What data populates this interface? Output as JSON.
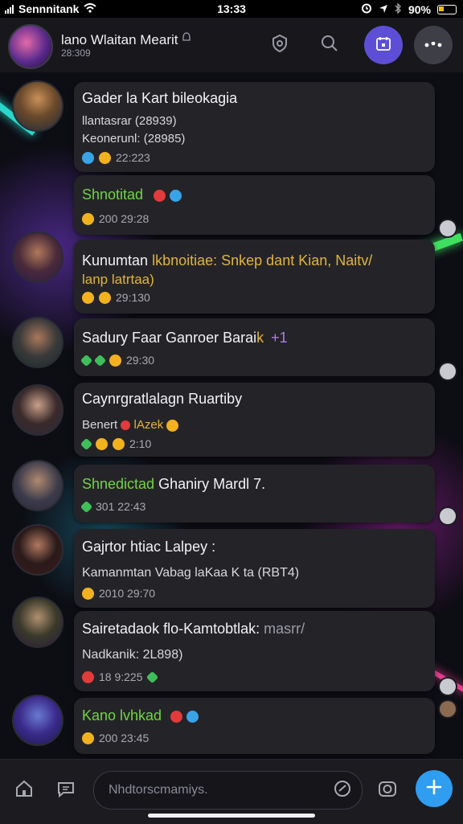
{
  "status_bar": {
    "carrier": "Sennnitank",
    "time": "13:33",
    "battery": "90%"
  },
  "header": {
    "title": "lano Wlaitan Mearit",
    "subtitle": "28:309"
  },
  "chats": [
    {
      "title": "Gader la Kart bileokagia",
      "line1": "llantasrar (28939)",
      "line2": "Keonerunl: (28985)",
      "meta": "22:223"
    },
    {
      "title": "Shnotitad",
      "meta": "200 29:28"
    },
    {
      "title": "Kunumtan",
      "title_accent": "lkbnoitiae: Snkep dant Kian, Naitv/",
      "line1": "lanp latrtaa)",
      "meta": "29:130"
    },
    {
      "title": "Sadury Faar Ganroer Barai",
      "title_accent": "k",
      "title_suffix": "+1",
      "meta": "29:30"
    },
    {
      "title": "Caynrgratlalagn Ruartiby",
      "line1": "Benert",
      "line1_accent": "lAzek",
      "meta": "2:10"
    },
    {
      "title": "Shnedictad",
      "title_rest": "Ghaniry Mardl 7.",
      "meta": "301  22:43"
    },
    {
      "title": "Gajrtor htiac Lalpey :",
      "line1": "Kamanmtan Vabag laKaa K ta (RBT4)",
      "meta": "2010  29:70"
    },
    {
      "title": "Sairetadaok flo-Kamtobtlak:",
      "title_muted": "masrr/",
      "line1": "Nadkanik: 2L898)",
      "meta": "18    9:225"
    },
    {
      "title": "Kano lvhkad",
      "meta": "200  23:45"
    }
  ],
  "composer": {
    "placeholder": "Nhdtorscmamiys."
  },
  "icons": {
    "header": [
      "shield-icon",
      "search-icon",
      "calendar-icon",
      "more-icon"
    ],
    "bottom": [
      "home-icon",
      "chat-icon",
      "sticker-icon",
      "camera-icon",
      "plus-icon"
    ]
  },
  "colors": {
    "accent_purple": "#5c4fd6",
    "fab_blue": "#2f9df0",
    "highlight_green": "#6fd53f",
    "highlight_gold": "#e3b43c"
  }
}
